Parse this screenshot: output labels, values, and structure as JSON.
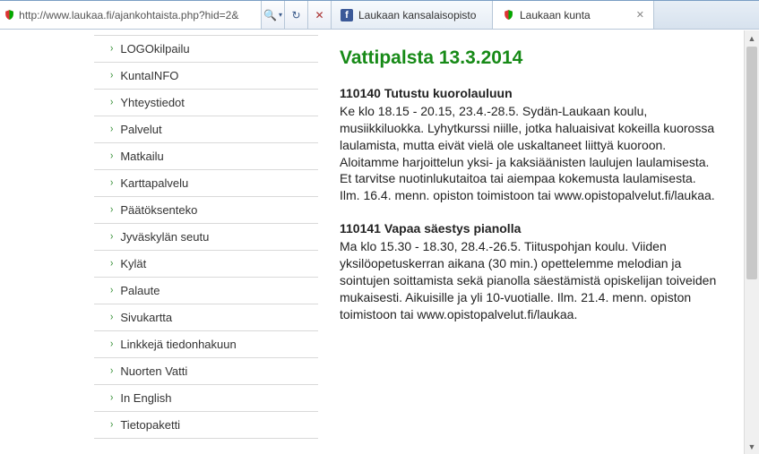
{
  "browser": {
    "url": "http://www.laukaa.fi/ajankohtaista.php?hid=2&",
    "search_icon_title": "search",
    "refresh_icon_title": "refresh",
    "stop_icon_title": "stop",
    "tabs": [
      {
        "label": "Laukaan kansalaisopisto",
        "icon": "fb",
        "active": false
      },
      {
        "label": "Laukaan kunta",
        "icon": "shield",
        "active": true
      }
    ]
  },
  "sidebar": {
    "items": [
      {
        "label": "LOGOkilpailu"
      },
      {
        "label": "KuntaINFO"
      },
      {
        "label": "Yhteystiedot"
      },
      {
        "label": "Palvelut"
      },
      {
        "label": "Matkailu"
      },
      {
        "label": "Karttapalvelu"
      },
      {
        "label": "Päätöksenteko"
      },
      {
        "label": "Jyväskylän seutu"
      },
      {
        "label": "Kylät"
      },
      {
        "label": "Palaute"
      },
      {
        "label": "Sivukartta"
      },
      {
        "label": "Linkkejä tiedonhakuun"
      },
      {
        "label": "Nuorten Vatti"
      },
      {
        "label": "In English"
      },
      {
        "label": "Tietopaketti"
      }
    ]
  },
  "content": {
    "title": "Vattipalsta 13.3.2014",
    "articles": [
      {
        "heading": "110140 Tutustu kuorolauluun",
        "body": "Ke klo 18.15 - 20.15, 23.4.-28.5. Sydän-Laukaan koulu, musiikkiluokka. Lyhytkurssi niille, jotka haluaisivat kokeilla kuorossa laulamista, mutta eivät vielä ole uskaltaneet liittyä kuoroon. Aloitamme harjoittelun yksi- ja kaksiäänisten laulujen laulamisesta. Et tarvitse nuotinlukutaitoa tai aiempaa kokemusta laulamisesta. Ilm. 16.4. menn. opiston toimistoon tai www.opistopalvelut.fi/laukaa."
      },
      {
        "heading": "110141 Vapaa säestys pianolla",
        "body": "Ma klo 15.30 - 18.30, 28.4.-26.5. Tiituspohjan koulu. Viiden yksilöopetuskerran aikana (30 min.) opettelemme melodian ja sointujen soittamista sekä pianolla säestämistä opiskelijan toiveiden mukaisesti. Aikuisille ja yli 10-vuotialle. Ilm. 21.4. menn. opiston toimistoon tai www.opistopalvelut.fi/laukaa."
      }
    ]
  }
}
